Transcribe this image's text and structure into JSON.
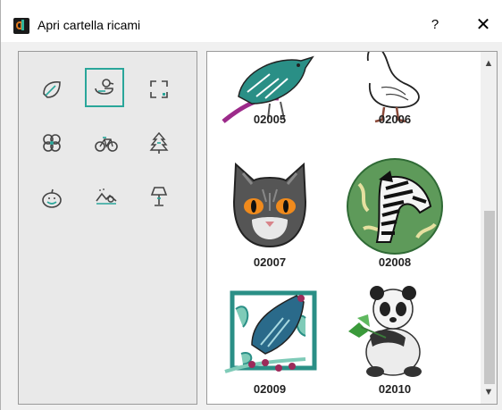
{
  "window": {
    "title": "Apri cartella ricami",
    "help_label": "?",
    "close_label": "✕"
  },
  "categories": [
    {
      "name": "leaf",
      "selected": false
    },
    {
      "name": "duck",
      "selected": true
    },
    {
      "name": "frame",
      "selected": false
    },
    {
      "name": "flower",
      "selected": false
    },
    {
      "name": "bicycle",
      "selected": false
    },
    {
      "name": "tree",
      "selected": false
    },
    {
      "name": "pumpkin",
      "selected": false
    },
    {
      "name": "landscape",
      "selected": false
    },
    {
      "name": "lamp",
      "selected": false
    }
  ],
  "designs": [
    {
      "code": "02005",
      "icon": "bird-branch-icon"
    },
    {
      "code": "02006",
      "icon": "duck-sketch-icon"
    },
    {
      "code": "02007",
      "icon": "cat-face-icon"
    },
    {
      "code": "02008",
      "icon": "zebra-circle-icon"
    },
    {
      "code": "02009",
      "icon": "bird-frame-icon"
    },
    {
      "code": "02010",
      "icon": "panda-icon"
    }
  ],
  "scroll": {
    "up_glyph": "^",
    "down_glyph": "v"
  },
  "colors": {
    "accent": "#2aa69a",
    "brand_orange": "#e07a1f"
  }
}
